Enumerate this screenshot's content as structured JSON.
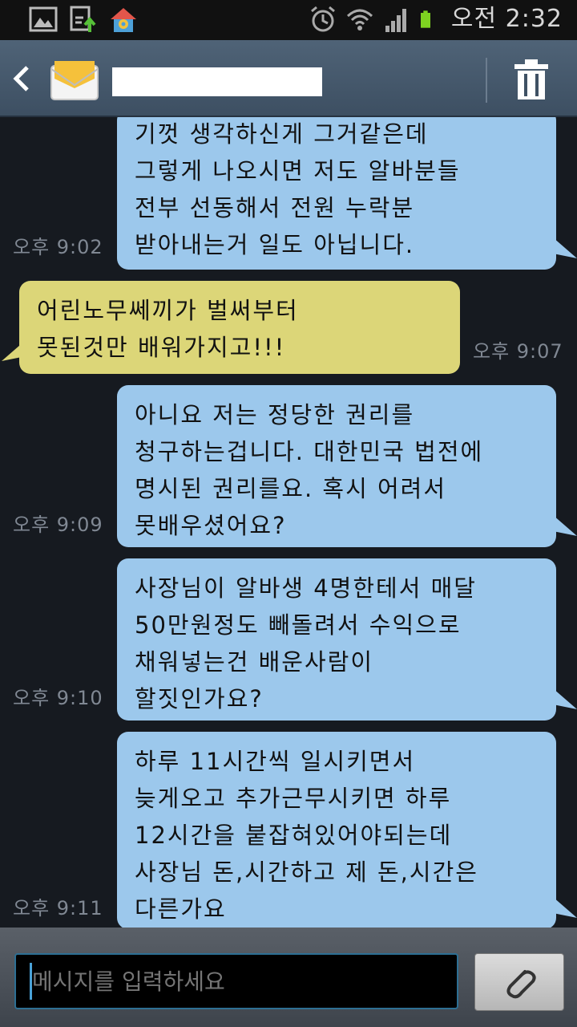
{
  "status_bar": {
    "time": "오전 2:32",
    "icons": [
      "gallery-icon",
      "download-icon",
      "settings-app-icon",
      "alarm-icon",
      "wifi-icon",
      "signal-icon",
      "battery-icon"
    ]
  },
  "header": {
    "contact_name": ""
  },
  "messages": [
    {
      "direction": "sent",
      "lines": [
        "기껏 생각하신게 그거같은데",
        "그렇게 나오시면 저도 알바분들",
        "전부 선동해서 전원 누락분",
        "받아내는거 일도 아닙니다."
      ],
      "time": "오후 9:02"
    },
    {
      "direction": "received",
      "lines": [
        "어린노무쎄끼가  벌써부터",
        "못된것만 배워가지고!!!"
      ],
      "time": "오후 9:07"
    },
    {
      "direction": "sent",
      "lines": [
        "아니요 저는 정당한 권리를",
        "청구하는겁니다. 대한민국 법전에",
        "명시된 권리를요. 혹시 어려서",
        "못배우셨어요?"
      ],
      "time": "오후 9:09"
    },
    {
      "direction": "sent",
      "lines": [
        "사장님이 알바생 4명한테서 매달",
        "50만원정도 빼돌려서 수익으로",
        "채워넣는건 배운사람이",
        "할짓인가요?"
      ],
      "time": "오후 9:10"
    },
    {
      "direction": "sent",
      "lines": [
        "하루 11시간씩 일시키면서",
        "늦게오고 추가근무시키면 하루",
        "12시간을 붙잡혀있어야되는데",
        "사장님 돈,시간하고 제 돈,시간은",
        "다른가요"
      ],
      "time": "오후 9:11"
    }
  ],
  "input": {
    "placeholder": "메시지를 입력하세요"
  },
  "colors": {
    "sent_bubble": "#9cc8ec",
    "received_bubble": "#dcd678",
    "background": "#161a20",
    "header": "#4a5d70"
  }
}
